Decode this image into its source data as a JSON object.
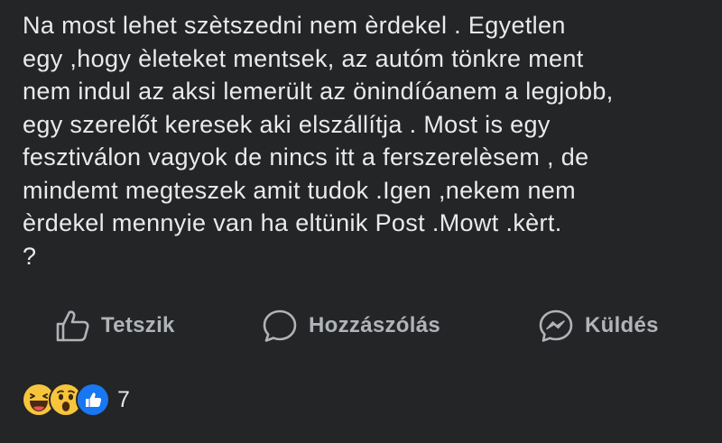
{
  "post": {
    "text": "Na most lehet szètszedni nem èrdekel . Egyetlen\negy ,hogy èleteket mentsek, az autóm tönkre ment\nnem indul az aksi lemerült az önindíóanem a legjobb,\negy szerelőt keresek aki elszállítja . Most is egy\nfesztiválon vagyok  de nincs itt a ferszerelèsem , de\nmindemt megteszek amit tudok .Igen ,nekem nem\nèrdekel mennyie van ha eltünik Post .Mowt .kèrt.\n?"
  },
  "actions": {
    "like": {
      "label": "Tetszik",
      "icon": "thumbs-up-icon"
    },
    "comment": {
      "label": "Hozzászólás",
      "icon": "comment-bubble-icon"
    },
    "send": {
      "label": "Küldés",
      "icon": "messenger-icon"
    }
  },
  "reactions": {
    "icons": [
      "haha-emoji-icon",
      "wow-emoji-icon",
      "like-reaction-icon"
    ],
    "count": "7"
  },
  "colors": {
    "background": "#242526",
    "text": "#e9eaec",
    "action_text": "#b0b3b8",
    "like_blue": "#1877f2",
    "emoji_yellow": "#f7c53c"
  }
}
